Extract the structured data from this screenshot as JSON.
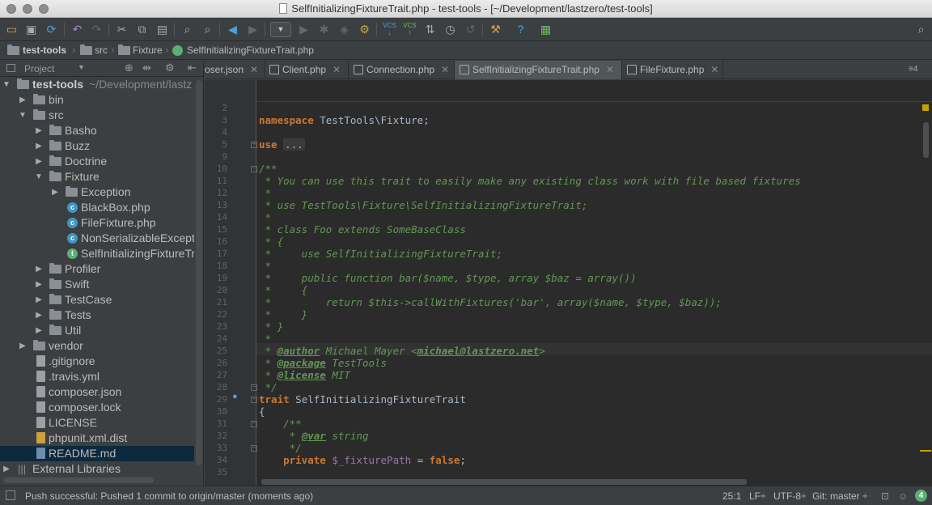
{
  "window": {
    "title": "SelfInitializingFixtureTrait.php - test-tools - [~/Development/lastzero/test-tools]"
  },
  "toolbar": {
    "icons": [
      "open-folder-icon",
      "save-icon",
      "sync-icon",
      "undo-icon",
      "redo-icon",
      "cut-icon",
      "copy-icon",
      "paste-icon",
      "find-icon",
      "replace-icon",
      "back-icon",
      "forward-icon",
      "run-config-combo",
      "run-icon",
      "debug-icon",
      "coverage-icon",
      "profile-icon",
      "vcs-update-icon",
      "vcs-commit-icon",
      "vcs-compare-icon",
      "vcs-history-icon",
      "vcs-revert-icon",
      "settings-icon",
      "help-icon",
      "terminal-icon",
      "search-everywhere-icon"
    ],
    "vcs_label": "VCS"
  },
  "navbar": {
    "crumbs": [
      "test-tools",
      "src",
      "Fixture",
      "SelfInitializingFixtureTrait.php"
    ]
  },
  "sidebar": {
    "header": "Project",
    "root_label": "test-tools",
    "root_path": "~/Development/lastz",
    "items": [
      {
        "label": "bin",
        "type": "folder",
        "depth": 1,
        "expanded": false
      },
      {
        "label": "src",
        "type": "folder",
        "depth": 1,
        "expanded": true
      },
      {
        "label": "Basho",
        "type": "folder",
        "depth": 2,
        "expanded": false
      },
      {
        "label": "Buzz",
        "type": "folder",
        "depth": 2,
        "expanded": false
      },
      {
        "label": "Doctrine",
        "type": "folder",
        "depth": 2,
        "expanded": false
      },
      {
        "label": "Fixture",
        "type": "folder",
        "depth": 2,
        "expanded": true
      },
      {
        "label": "Exception",
        "type": "folder",
        "depth": 3,
        "expanded": false
      },
      {
        "label": "BlackBox.php",
        "type": "class",
        "depth": 3
      },
      {
        "label": "FileFixture.php",
        "type": "class",
        "depth": 3
      },
      {
        "label": "NonSerializableExcepti",
        "type": "class",
        "depth": 3
      },
      {
        "label": "SelfInitializingFixtureTr",
        "type": "trait",
        "depth": 3
      },
      {
        "label": "Profiler",
        "type": "folder",
        "depth": 2,
        "expanded": false
      },
      {
        "label": "Swift",
        "type": "folder",
        "depth": 2,
        "expanded": false
      },
      {
        "label": "TestCase",
        "type": "folder",
        "depth": 2,
        "expanded": false
      },
      {
        "label": "Tests",
        "type": "folder",
        "depth": 2,
        "expanded": false
      },
      {
        "label": "Util",
        "type": "folder",
        "depth": 2,
        "expanded": false
      },
      {
        "label": "vendor",
        "type": "folder",
        "depth": 1,
        "expanded": false
      },
      {
        "label": ".gitignore",
        "type": "file",
        "depth": 1
      },
      {
        "label": ".travis.yml",
        "type": "file",
        "depth": 1
      },
      {
        "label": "composer.json",
        "type": "file",
        "depth": 1
      },
      {
        "label": "composer.lock",
        "type": "file",
        "depth": 1
      },
      {
        "label": "LICENSE",
        "type": "file",
        "depth": 1
      },
      {
        "label": "phpunit.xml.dist",
        "type": "xml",
        "depth": 1
      },
      {
        "label": "README.md",
        "type": "md",
        "depth": 1,
        "selected": true
      },
      {
        "label": "External Libraries",
        "type": "lib",
        "depth": 0,
        "expanded": false
      }
    ]
  },
  "tabs": [
    {
      "label": "oser.json",
      "active": false
    },
    {
      "label": "Client.php",
      "active": false
    },
    {
      "label": "Connection.php",
      "active": false
    },
    {
      "label": "SelfInitializingFixtureTrait.php",
      "active": true
    },
    {
      "label": "FileFixture.php",
      "active": false
    }
  ],
  "tab_overflow": "≡4",
  "editor": {
    "lines": [
      {
        "n": "2",
        "html": ""
      },
      {
        "n": "3",
        "html": "<span class=\"kw\">namespace</span> TestTools\\Fixture;"
      },
      {
        "n": "4",
        "html": ""
      },
      {
        "n": "5",
        "html": "<span class=\"kw\">use</span> <span class=\"fold-box\">...</span>"
      },
      {
        "n": "9",
        "html": ""
      },
      {
        "n": "10",
        "html": "<span class=\"cm\">/**</span>"
      },
      {
        "n": "11",
        "html": "<span class=\"cm\"> * You can use this trait to easily make any existing class work with file based fixtures</span>"
      },
      {
        "n": "12",
        "html": "<span class=\"cm\"> *</span>"
      },
      {
        "n": "13",
        "html": "<span class=\"cm\"> * use TestTools\\Fixture\\SelfInitializingFixtureTrait;</span>"
      },
      {
        "n": "14",
        "html": "<span class=\"cm\"> *</span>"
      },
      {
        "n": "15",
        "html": "<span class=\"cm\"> * class Foo extends SomeBaseClass</span>"
      },
      {
        "n": "16",
        "html": "<span class=\"cm\"> * {</span>"
      },
      {
        "n": "17",
        "html": "<span class=\"cm\"> *     use SelfInitializingFixtureTrait;</span>"
      },
      {
        "n": "18",
        "html": "<span class=\"cm\"> *</span>"
      },
      {
        "n": "19",
        "html": "<span class=\"cm\"> *     public function bar($name, $type, array $baz = array())</span>"
      },
      {
        "n": "20",
        "html": "<span class=\"cm\"> *     {</span>"
      },
      {
        "n": "21",
        "html": "<span class=\"cm\"> *         return $this->callWithFixtures('bar', array($name, $type, $baz));</span>"
      },
      {
        "n": "22",
        "html": "<span class=\"cm\"> *     }</span>"
      },
      {
        "n": "23",
        "html": "<span class=\"cm\"> * }</span>"
      },
      {
        "n": "24",
        "html": "<span class=\"cm\"> *</span>"
      },
      {
        "n": "25",
        "html": "<span class=\"cm\"> * </span><span class=\"tag\">@author</span><span class=\"cm\"> Michael Mayer &lt;</span><span class=\"tag\">michael@lastzero.net</span><span class=\"cm\">&gt;</span>"
      },
      {
        "n": "26",
        "html": "<span class=\"cm\"> * </span><span class=\"tag\">@package</span><span class=\"cm\"> TestTools</span>"
      },
      {
        "n": "27",
        "html": "<span class=\"cm\"> * </span><span class=\"tag\">@license</span><span class=\"cm\"> MIT</span>"
      },
      {
        "n": "28",
        "html": "<span class=\"cm\"> */</span>"
      },
      {
        "n": "29",
        "html": "<span class=\"kw\">trait</span> SelfInitializingFixtureTrait"
      },
      {
        "n": "30",
        "html": "{"
      },
      {
        "n": "31",
        "html": "    <span class=\"cm\">/**</span>"
      },
      {
        "n": "32",
        "html": "<span class=\"cm\">     * </span><span class=\"tag\">@var</span><span class=\"cm\"> string</span>"
      },
      {
        "n": "33",
        "html": "<span class=\"cm\">     */</span>"
      },
      {
        "n": "34",
        "html": "    <span class=\"kw\">private</span> <span class=\"var\">$_fixturePath</span> = <span class=\"kw\">false</span>;"
      },
      {
        "n": "35",
        "html": ""
      }
    ]
  },
  "status": {
    "message": "Push successful: Pushed 1 commit to origin/master (moments ago)",
    "position": "25:1",
    "line_sep": "LF÷",
    "encoding": "UTF-8÷",
    "branch": "Git: master ÷",
    "notifications": "4"
  },
  "colors": {
    "background": "#2b2b2b",
    "keyword": "#cc7832",
    "doc_comment": "#629755",
    "variable": "#9876aa"
  }
}
